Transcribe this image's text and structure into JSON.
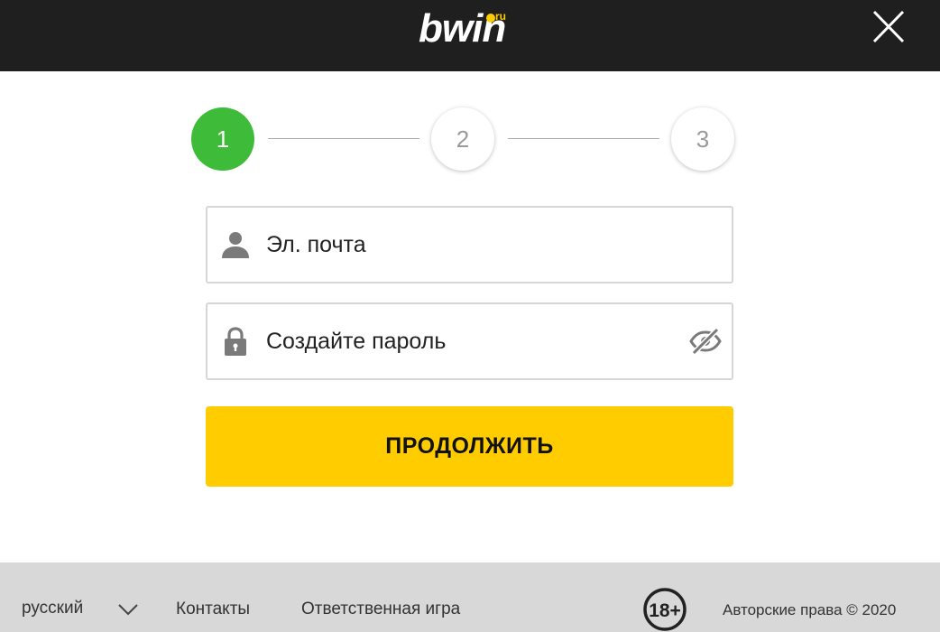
{
  "colors": {
    "header_bg": "#1f1f1f",
    "brand_yellow": "#ffcc00",
    "step_active": "#3fbb3a",
    "step_inactive_text": "#9a9a9a",
    "footer_bg": "#d8d8d8"
  },
  "header": {
    "logo_text": "bwin",
    "logo_suffix": "ru",
    "close_icon": "close-icon"
  },
  "stepper": {
    "steps": [
      {
        "number": "1",
        "state": "active"
      },
      {
        "number": "2",
        "state": "inactive"
      },
      {
        "number": "3",
        "state": "inactive"
      }
    ]
  },
  "form": {
    "email": {
      "placeholder": "Эл. почта",
      "value": "",
      "icon": "user-icon"
    },
    "password": {
      "placeholder": "Создайте пароль",
      "value": "",
      "icon": "lock-icon",
      "toggle_icon": "eye-off-icon"
    },
    "continue_label": "ПРОДОЛЖИТЬ"
  },
  "footer": {
    "language": "русский",
    "contacts": "Контакты",
    "responsible_gaming": "Ответственная игра",
    "age_badge": "18+",
    "copyright": "Авторские права © 2020"
  }
}
